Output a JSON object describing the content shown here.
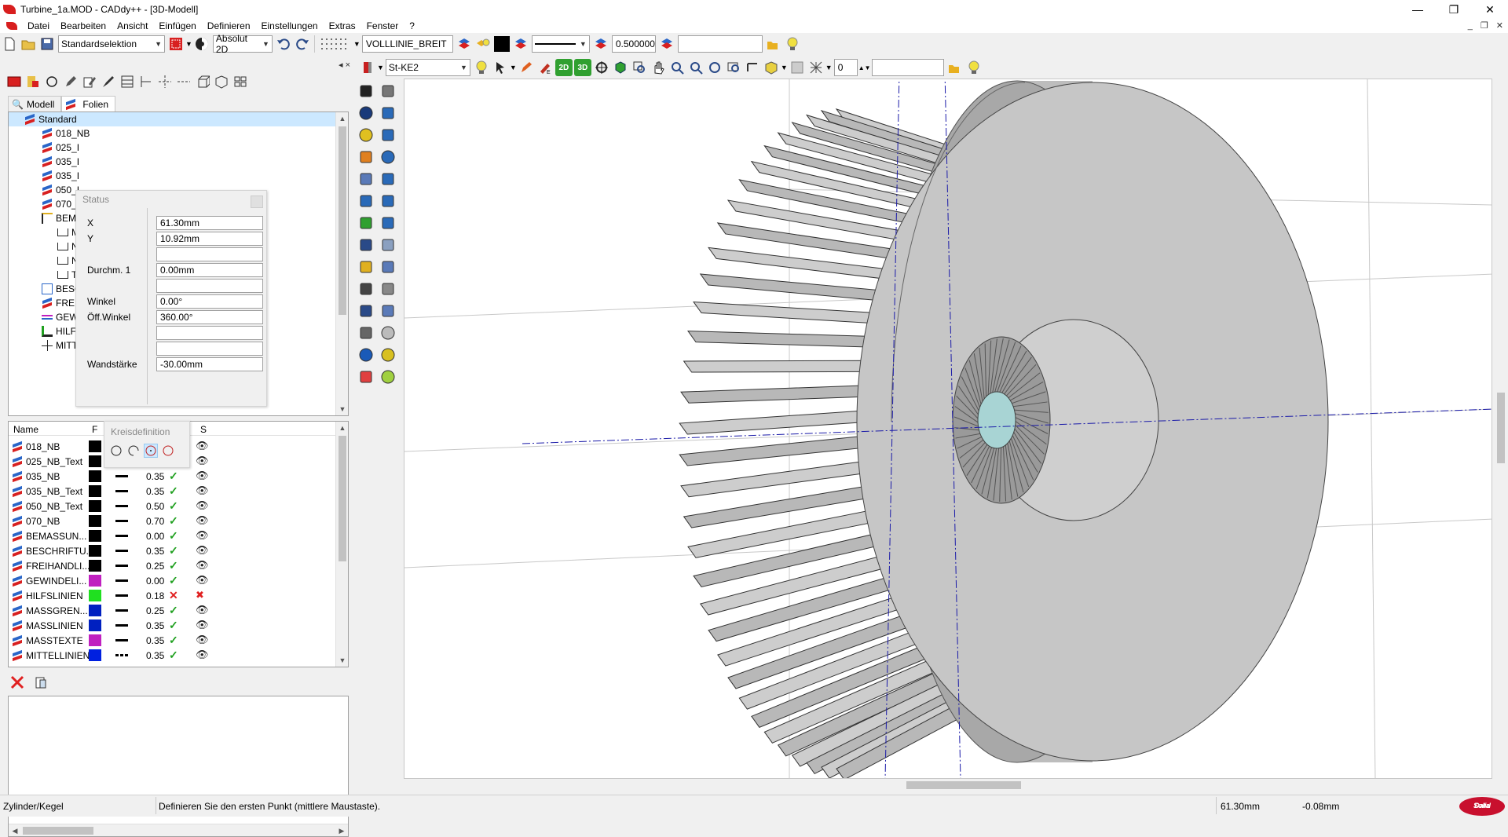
{
  "window": {
    "title": "Turbine_1a.MOD   - CADdy++ - [3D-Modell]",
    "controls": [
      "—",
      "❐",
      "✕"
    ]
  },
  "menu": {
    "items": [
      "Datei",
      "Bearbeiten",
      "Ansicht",
      "Einfügen",
      "Definieren",
      "Einstellungen",
      "Extras",
      "Fenster",
      "?"
    ],
    "mdi_controls": [
      "_",
      "❐",
      "✕"
    ]
  },
  "toolbar1": {
    "selection_mode": "Standardselektion",
    "coord_mode": "Absolut 2D",
    "line_type": "VOLLLINIE_BREIT",
    "line_width": "0.500000",
    "extra_field": ""
  },
  "toolbar2": {
    "style": "St-KE2",
    "btn_2d": "2D",
    "btn_3d": "3D",
    "counter": "0",
    "extra_field": ""
  },
  "left_panel": {
    "close_glyph": "×",
    "pin_glyph": "◂",
    "tabs": [
      "Modell",
      "Folien"
    ],
    "tree": {
      "root": "Standard",
      "items": [
        "018_NB",
        "025_I",
        "035_I",
        "035_I",
        "050_I",
        "070_I",
        "BEM",
        "M",
        "N",
        "N",
        "T",
        "BESC",
        "FREII",
        "GEW",
        "HILF",
        "MITTE"
      ]
    },
    "status_popup": {
      "title": "Status",
      "rows": [
        {
          "label": "X",
          "value": "61.30mm"
        },
        {
          "label": "Y",
          "value": "10.92mm"
        },
        {
          "label": "",
          "value": ""
        },
        {
          "label": "Durchm. 1",
          "value": "0.00mm"
        },
        {
          "label": "",
          "value": ""
        },
        {
          "label": "Winkel",
          "value": "0.00°"
        },
        {
          "label": "Öff.Winkel",
          "value": "360.00°"
        },
        {
          "label": "",
          "value": ""
        },
        {
          "label": "",
          "value": ""
        },
        {
          "label": "Wandstärke",
          "value": "-30.00mm"
        }
      ]
    },
    "layer_list": {
      "headers": {
        "name": "Name",
        "f": "F",
        "s": "S"
      },
      "rows": [
        {
          "name": "018_NB",
          "color": "#000000",
          "width": "",
          "line": "solid",
          "visible": true,
          "active": true
        },
        {
          "name": "025_NB_Text",
          "color": "#000000",
          "width": "",
          "line": "solid",
          "visible": true,
          "active": true
        },
        {
          "name": "035_NB",
          "color": "#000000",
          "width": "0.35",
          "line": "solid",
          "visible": true,
          "active": true
        },
        {
          "name": "035_NB_Text",
          "color": "#000000",
          "width": "0.35",
          "line": "solid",
          "visible": true,
          "active": true
        },
        {
          "name": "050_NB_Text",
          "color": "#000000",
          "width": "0.50",
          "line": "solid",
          "visible": true,
          "active": true
        },
        {
          "name": "070_NB",
          "color": "#000000",
          "width": "0.70",
          "line": "solid",
          "visible": true,
          "active": true
        },
        {
          "name": "BEMASSUN...",
          "color": "#000000",
          "width": "0.00",
          "line": "solid",
          "visible": true,
          "active": true
        },
        {
          "name": "BESCHRIFTU...",
          "color": "#000000",
          "width": "0.35",
          "line": "solid",
          "visible": true,
          "active": true
        },
        {
          "name": "FREIHANDLI...",
          "color": "#000000",
          "width": "0.25",
          "line": "solid",
          "visible": true,
          "active": true
        },
        {
          "name": "GEWINDELI...",
          "color": "#c020c0",
          "width": "0.00",
          "line": "solid",
          "visible": true,
          "active": true
        },
        {
          "name": "HILFSLINIEN",
          "color": "#20e020",
          "width": "0.18",
          "line": "solid",
          "visible": false,
          "active": false
        },
        {
          "name": "MASSGREN...",
          "color": "#0020c0",
          "width": "0.25",
          "line": "solid",
          "visible": true,
          "active": true
        },
        {
          "name": "MASSLINIEN",
          "color": "#0020c0",
          "width": "0.35",
          "line": "solid",
          "visible": true,
          "active": true
        },
        {
          "name": "MASSTEXTE",
          "color": "#c020c0",
          "width": "0.35",
          "line": "solid",
          "visible": true,
          "active": true
        },
        {
          "name": "MITTELLINIEN",
          "color": "#0020e0",
          "width": "0.35",
          "line": "dash",
          "visible": true,
          "active": true
        }
      ]
    },
    "kreis_popup": {
      "title": "Kreisdefinition"
    }
  },
  "statusbar": {
    "mode": "Zylinder/Kegel",
    "hint": "Definieren Sie den ersten Punkt (mittlere Maustaste).",
    "x": "61.30mm",
    "y": "-0.08mm",
    "logo_line1": "Data",
    "logo_line2": "Solid"
  },
  "colors": {
    "accent_red": "#d81e1e",
    "model_face": "#c4c4c4",
    "axis_blue": "#1a1aa8"
  }
}
